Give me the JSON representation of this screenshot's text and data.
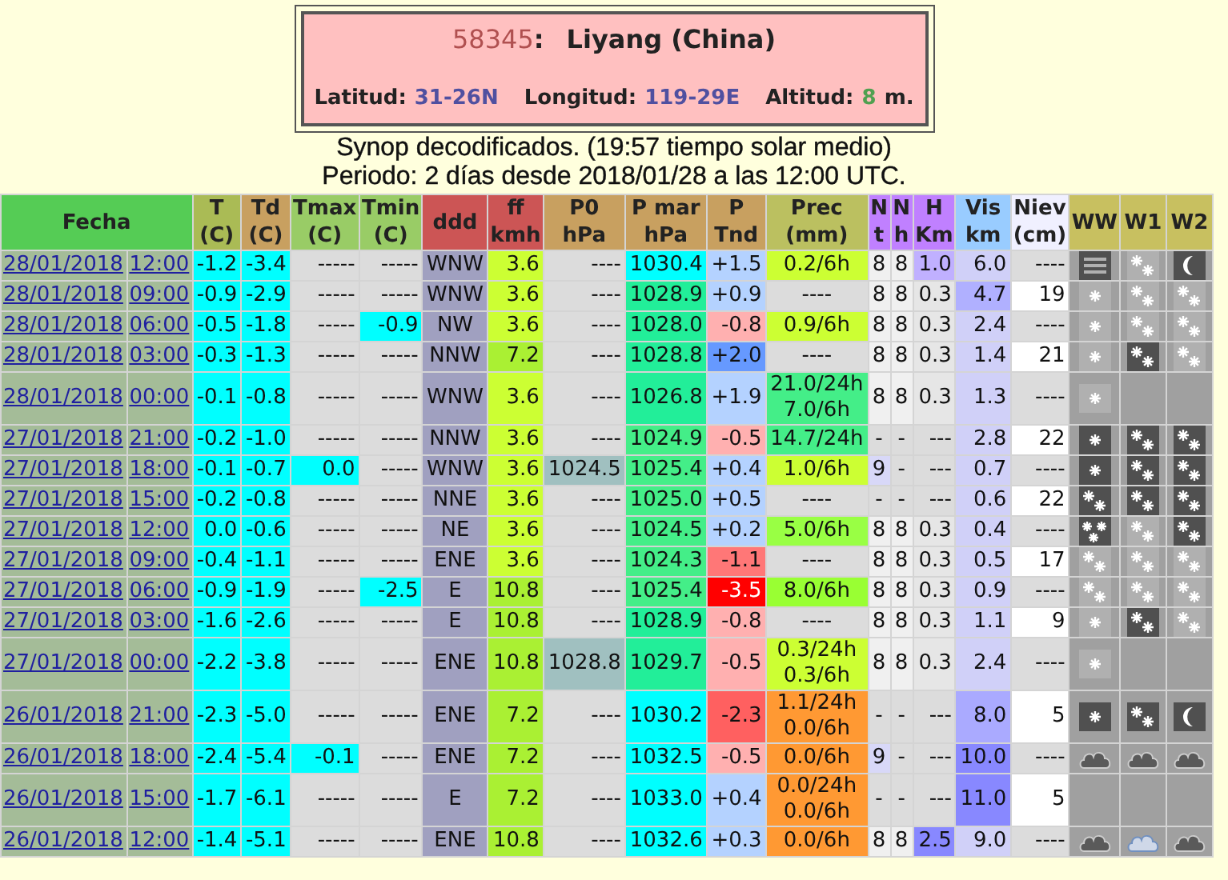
{
  "station": {
    "id": "58345",
    "id_suffix": ":",
    "name": "Liyang (China)",
    "coords": [
      {
        "label": "Latitud:",
        "value": "31-26N",
        "color": "#5050a0"
      },
      {
        "label": "Longitud:",
        "value": "119-29E",
        "color": "#5050a0"
      },
      {
        "label": "Altitud:",
        "value": "8",
        "color": "#50a050",
        "unit": "m."
      }
    ]
  },
  "subtitle": "Synop decodificados. (19:57 tiempo solar medio)",
  "period": "Periodo: 2 días desde 2018/01/28 a las 12:00 UTC.",
  "columns": [
    {
      "label": "Fecha",
      "color": "#55cc55"
    },
    {
      "label": "T\n(C)",
      "color": "#aabb55"
    },
    {
      "label": "Td\n(C)",
      "color": "#c8a060"
    },
    {
      "label": "Tmax\n(C)",
      "color": "#99cc66"
    },
    {
      "label": "Tmin\n(C)",
      "color": "#99cc66"
    },
    {
      "label": "ddd",
      "color": "#cc5555"
    },
    {
      "label": "ff\nkmh",
      "color": "#cc5555"
    },
    {
      "label": "P0\nhPa",
      "color": "#c8a060"
    },
    {
      "label": "P mar\nhPa",
      "color": "#c8a060"
    },
    {
      "label": "P\nTnd",
      "color": "#c8a060"
    },
    {
      "label": "Prec\n(mm)",
      "color": "#bbc060"
    },
    {
      "label": "N\nt",
      "color": "#c080ff"
    },
    {
      "label": "N\nh",
      "color": "#c080ff"
    },
    {
      "label": "H\nKm",
      "color": "#c080ff"
    },
    {
      "label": "Vis\nkm",
      "color": "#99ccff"
    },
    {
      "label": "Niev\n(cm)",
      "color": "#f0f0ff"
    },
    {
      "label": "WW",
      "color": "#c8c060"
    },
    {
      "label": "W1",
      "color": "#c8c060"
    },
    {
      "label": "W2",
      "color": "#c8c060"
    }
  ],
  "rows": [
    {
      "date": "28/01/2018",
      "time": "12:00",
      "cells": [
        {
          "text": "-1.2",
          "color": "#00ffff"
        },
        {
          "text": "-3.4",
          "color": "#00ffff"
        },
        {
          "text": "-----",
          "color": "#dcdcdc"
        },
        {
          "text": "-----",
          "color": "#dcdcdc"
        },
        {
          "text": "WNW",
          "color": "#a0a0c0"
        },
        {
          "text": "3.6",
          "color": "#ccff33"
        },
        {
          "text": "----",
          "color": "#dcdcdc"
        },
        {
          "text": "1030.4",
          "color": "#00ffff"
        },
        {
          "text": "+1.5",
          "color": "#b4d2ff"
        },
        {
          "text": "0.2/6h",
          "color": "#ccff33"
        },
        {
          "text": "8",
          "color": "#f0f0f0"
        },
        {
          "text": "8",
          "color": "#f0f0f0"
        },
        {
          "text": "1.0",
          "color": "#c0b0ff"
        },
        {
          "text": "6.0",
          "color": "#d0d0f8"
        },
        {
          "text": "----",
          "color": "#dcdcdc"
        }
      ],
      "icons": [
        {
          "kind": "fog",
          "dark": true
        },
        {
          "kind": "flakes",
          "dark": false
        },
        {
          "kind": "moon",
          "dark": true
        }
      ]
    },
    {
      "date": "28/01/2018",
      "time": "09:00",
      "cells": [
        {
          "text": "-0.9",
          "color": "#00ffff"
        },
        {
          "text": "-2.9",
          "color": "#00ffff"
        },
        {
          "text": "-----",
          "color": "#dcdcdc"
        },
        {
          "text": "-----",
          "color": "#dcdcdc"
        },
        {
          "text": "WNW",
          "color": "#a0a0c0"
        },
        {
          "text": "3.6",
          "color": "#ccff33"
        },
        {
          "text": "----",
          "color": "#dcdcdc"
        },
        {
          "text": "1028.9",
          "color": "#22ee99"
        },
        {
          "text": "+0.9",
          "color": "#b4d2ff"
        },
        {
          "text": "----",
          "color": "#dcdcdc"
        },
        {
          "text": "8",
          "color": "#f0f0f0"
        },
        {
          "text": "8",
          "color": "#f0f0f0"
        },
        {
          "text": "0.3",
          "color": "#e6e6e6"
        },
        {
          "text": "4.7",
          "color": "#b0b0ff"
        },
        {
          "text": "19",
          "color": "#ffffff"
        }
      ],
      "icons": [
        {
          "kind": "flake",
          "dark": false
        },
        {
          "kind": "flakes",
          "dark": false
        },
        {
          "kind": "flakes",
          "dark": false
        }
      ]
    },
    {
      "date": "28/01/2018",
      "time": "06:00",
      "cells": [
        {
          "text": "-0.5",
          "color": "#00ffff"
        },
        {
          "text": "-1.8",
          "color": "#00ffff"
        },
        {
          "text": "-----",
          "color": "#dcdcdc"
        },
        {
          "text": "-0.9",
          "color": "#00ffff"
        },
        {
          "text": "NW",
          "color": "#a0a0c0"
        },
        {
          "text": "3.6",
          "color": "#ccff33"
        },
        {
          "text": "----",
          "color": "#dcdcdc"
        },
        {
          "text": "1028.0",
          "color": "#22ee99"
        },
        {
          "text": "-0.8",
          "color": "#ffb0b0"
        },
        {
          "text": "0.9/6h",
          "color": "#ccff33"
        },
        {
          "text": "8",
          "color": "#f0f0f0"
        },
        {
          "text": "8",
          "color": "#f0f0f0"
        },
        {
          "text": "0.3",
          "color": "#e6e6e6"
        },
        {
          "text": "2.4",
          "color": "#d0d0f8"
        },
        {
          "text": "----",
          "color": "#dcdcdc"
        }
      ],
      "icons": [
        {
          "kind": "flake",
          "dark": false
        },
        {
          "kind": "flakes",
          "dark": false
        },
        {
          "kind": "flakes",
          "dark": false
        }
      ]
    },
    {
      "date": "28/01/2018",
      "time": "03:00",
      "cells": [
        {
          "text": "-0.3",
          "color": "#00ffff"
        },
        {
          "text": "-1.3",
          "color": "#00ffff"
        },
        {
          "text": "-----",
          "color": "#dcdcdc"
        },
        {
          "text": "-----",
          "color": "#dcdcdc"
        },
        {
          "text": "NNW",
          "color": "#a0a0c0"
        },
        {
          "text": "7.2",
          "color": "#aaf033"
        },
        {
          "text": "----",
          "color": "#dcdcdc"
        },
        {
          "text": "1028.8",
          "color": "#22ee99"
        },
        {
          "text": "+2.0",
          "color": "#6699ff"
        },
        {
          "text": "----",
          "color": "#dcdcdc"
        },
        {
          "text": "8",
          "color": "#f0f0f0"
        },
        {
          "text": "8",
          "color": "#f0f0f0"
        },
        {
          "text": "0.3",
          "color": "#e6e6e6"
        },
        {
          "text": "1.4",
          "color": "#d0d0f8"
        },
        {
          "text": "21",
          "color": "#ffffff"
        }
      ],
      "icons": [
        {
          "kind": "flake",
          "dark": false
        },
        {
          "kind": "flakes",
          "dark": true
        },
        {
          "kind": "flakes",
          "dark": false
        }
      ]
    },
    {
      "date": "28/01/2018",
      "time": "00:00",
      "cells": [
        {
          "text": "-0.1",
          "color": "#00ffff"
        },
        {
          "text": "-0.8",
          "color": "#00ffff"
        },
        {
          "text": "-----",
          "color": "#dcdcdc"
        },
        {
          "text": "-----",
          "color": "#dcdcdc"
        },
        {
          "text": "WNW",
          "color": "#a0a0c0"
        },
        {
          "text": "3.6",
          "color": "#ccff33"
        },
        {
          "text": "----",
          "color": "#dcdcdc"
        },
        {
          "text": "1026.8",
          "color": "#22ee99"
        },
        {
          "text": "+1.9",
          "color": "#b4d2ff"
        },
        {
          "text": "21.0/24h\n7.0/6h",
          "color": "#44ee88"
        },
        {
          "text": "8",
          "color": "#f0f0f0"
        },
        {
          "text": "8",
          "color": "#f0f0f0"
        },
        {
          "text": "0.3",
          "color": "#e6e6e6"
        },
        {
          "text": "1.3",
          "color": "#d0d0f8"
        },
        {
          "text": "----",
          "color": "#dcdcdc"
        }
      ],
      "icons": [
        {
          "kind": "flake",
          "dark": false
        }
      ]
    },
    {
      "date": "27/01/2018",
      "time": "21:00",
      "cells": [
        {
          "text": "-0.2",
          "color": "#00ffff"
        },
        {
          "text": "-1.0",
          "color": "#00ffff"
        },
        {
          "text": "-----",
          "color": "#dcdcdc"
        },
        {
          "text": "-----",
          "color": "#dcdcdc"
        },
        {
          "text": "NNW",
          "color": "#a0a0c0"
        },
        {
          "text": "3.6",
          "color": "#ccff33"
        },
        {
          "text": "----",
          "color": "#dcdcdc"
        },
        {
          "text": "1024.9",
          "color": "#44ee88"
        },
        {
          "text": "-0.5",
          "color": "#ffb0b0"
        },
        {
          "text": "14.7/24h",
          "color": "#44ee88"
        },
        {
          "text": "-",
          "color": "#dcdcdc"
        },
        {
          "text": "-",
          "color": "#dcdcdc"
        },
        {
          "text": "---",
          "color": "#dcdcdc"
        },
        {
          "text": "2.8",
          "color": "#d0d0f8"
        },
        {
          "text": "22",
          "color": "#ffffff"
        }
      ],
      "icons": [
        {
          "kind": "flake",
          "dark": true
        },
        {
          "kind": "flakes",
          "dark": true
        },
        {
          "kind": "flakes",
          "dark": true
        }
      ]
    },
    {
      "date": "27/01/2018",
      "time": "18:00",
      "cells": [
        {
          "text": "-0.1",
          "color": "#00ffff"
        },
        {
          "text": "-0.7",
          "color": "#00ffff"
        },
        {
          "text": "0.0",
          "color": "#00ffff"
        },
        {
          "text": "-----",
          "color": "#dcdcdc"
        },
        {
          "text": "WNW",
          "color": "#a0a0c0"
        },
        {
          "text": "3.6",
          "color": "#ccff33"
        },
        {
          "text": "1024.5",
          "color": "#a0c0c0"
        },
        {
          "text": "1025.4",
          "color": "#44ee88"
        },
        {
          "text": "+0.4",
          "color": "#b4d2ff"
        },
        {
          "text": "1.0/6h",
          "color": "#ccff33"
        },
        {
          "text": "9",
          "color": "#d8d8f8"
        },
        {
          "text": "-",
          "color": "#dcdcdc"
        },
        {
          "text": "---",
          "color": "#dcdcdc"
        },
        {
          "text": "0.7",
          "color": "#d0d0f8"
        },
        {
          "text": "----",
          "color": "#dcdcdc"
        }
      ],
      "icons": [
        {
          "kind": "flake",
          "dark": true
        },
        {
          "kind": "flakes",
          "dark": true
        },
        {
          "kind": "flakes",
          "dark": true
        }
      ]
    },
    {
      "date": "27/01/2018",
      "time": "15:00",
      "cells": [
        {
          "text": "-0.2",
          "color": "#00ffff"
        },
        {
          "text": "-0.8",
          "color": "#00ffff"
        },
        {
          "text": "-----",
          "color": "#dcdcdc"
        },
        {
          "text": "-----",
          "color": "#dcdcdc"
        },
        {
          "text": "NNE",
          "color": "#a0a0c0"
        },
        {
          "text": "3.6",
          "color": "#ccff33"
        },
        {
          "text": "----",
          "color": "#dcdcdc"
        },
        {
          "text": "1025.0",
          "color": "#44ee88"
        },
        {
          "text": "+0.5",
          "color": "#b4d2ff"
        },
        {
          "text": "----",
          "color": "#dcdcdc"
        },
        {
          "text": "-",
          "color": "#dcdcdc"
        },
        {
          "text": "-",
          "color": "#dcdcdc"
        },
        {
          "text": "---",
          "color": "#dcdcdc"
        },
        {
          "text": "0.6",
          "color": "#d0d0f8"
        },
        {
          "text": "22",
          "color": "#ffffff"
        }
      ],
      "icons": [
        {
          "kind": "flakes",
          "dark": true
        },
        {
          "kind": "flakes",
          "dark": true
        },
        {
          "kind": "flakes",
          "dark": true
        }
      ]
    },
    {
      "date": "27/01/2018",
      "time": "12:00",
      "cells": [
        {
          "text": "0.0",
          "color": "#00ffff"
        },
        {
          "text": "-0.6",
          "color": "#00ffff"
        },
        {
          "text": "-----",
          "color": "#dcdcdc"
        },
        {
          "text": "-----",
          "color": "#dcdcdc"
        },
        {
          "text": "NE",
          "color": "#a0a0c0"
        },
        {
          "text": "3.6",
          "color": "#ccff33"
        },
        {
          "text": "----",
          "color": "#dcdcdc"
        },
        {
          "text": "1024.5",
          "color": "#44ee88"
        },
        {
          "text": "+0.2",
          "color": "#b4d2ff"
        },
        {
          "text": "5.0/6h",
          "color": "#99ff44"
        },
        {
          "text": "8",
          "color": "#f0f0f0"
        },
        {
          "text": "8",
          "color": "#f0f0f0"
        },
        {
          "text": "0.3",
          "color": "#e6e6e6"
        },
        {
          "text": "0.4",
          "color": "#d0d0f8"
        },
        {
          "text": "----",
          "color": "#dcdcdc"
        }
      ],
      "icons": [
        {
          "kind": "flakes3",
          "dark": true
        },
        {
          "kind": "flakes",
          "dark": false
        },
        {
          "kind": "flakes",
          "dark": true
        }
      ]
    },
    {
      "date": "27/01/2018",
      "time": "09:00",
      "cells": [
        {
          "text": "-0.4",
          "color": "#00ffff"
        },
        {
          "text": "-1.1",
          "color": "#00ffff"
        },
        {
          "text": "-----",
          "color": "#dcdcdc"
        },
        {
          "text": "-----",
          "color": "#dcdcdc"
        },
        {
          "text": "ENE",
          "color": "#a0a0c0"
        },
        {
          "text": "3.6",
          "color": "#ccff33"
        },
        {
          "text": "----",
          "color": "#dcdcdc"
        },
        {
          "text": "1024.3",
          "color": "#44ee88"
        },
        {
          "text": "-1.1",
          "color": "#ff7777"
        },
        {
          "text": "----",
          "color": "#dcdcdc"
        },
        {
          "text": "8",
          "color": "#f0f0f0"
        },
        {
          "text": "8",
          "color": "#f0f0f0"
        },
        {
          "text": "0.3",
          "color": "#e6e6e6"
        },
        {
          "text": "0.5",
          "color": "#d0d0f8"
        },
        {
          "text": "17",
          "color": "#ffffff"
        }
      ],
      "icons": [
        {
          "kind": "flakes",
          "dark": false
        },
        {
          "kind": "flakes",
          "dark": false
        },
        {
          "kind": "flakes",
          "dark": false
        }
      ]
    },
    {
      "date": "27/01/2018",
      "time": "06:00",
      "cells": [
        {
          "text": "-0.9",
          "color": "#00ffff"
        },
        {
          "text": "-1.9",
          "color": "#00ffff"
        },
        {
          "text": "-----",
          "color": "#dcdcdc"
        },
        {
          "text": "-2.5",
          "color": "#00ffff"
        },
        {
          "text": "E",
          "color": "#a0a0c0"
        },
        {
          "text": "10.8",
          "color": "#aaf033"
        },
        {
          "text": "----",
          "color": "#dcdcdc"
        },
        {
          "text": "1025.4",
          "color": "#44ee88"
        },
        {
          "text": "-3.5",
          "color": "#ff0000"
        },
        {
          "text": "8.0/6h",
          "color": "#99ff33"
        },
        {
          "text": "8",
          "color": "#f0f0f0"
        },
        {
          "text": "8",
          "color": "#f0f0f0"
        },
        {
          "text": "0.3",
          "color": "#e6e6e6"
        },
        {
          "text": "0.9",
          "color": "#d0d0f8"
        },
        {
          "text": "----",
          "color": "#dcdcdc"
        }
      ],
      "icons": [
        {
          "kind": "flakes",
          "dark": false
        },
        {
          "kind": "flakes",
          "dark": false
        },
        {
          "kind": "flakes",
          "dark": false
        }
      ]
    },
    {
      "date": "27/01/2018",
      "time": "03:00",
      "cells": [
        {
          "text": "-1.6",
          "color": "#00ffff"
        },
        {
          "text": "-2.6",
          "color": "#00ffff"
        },
        {
          "text": "-----",
          "color": "#dcdcdc"
        },
        {
          "text": "-----",
          "color": "#dcdcdc"
        },
        {
          "text": "E",
          "color": "#a0a0c0"
        },
        {
          "text": "10.8",
          "color": "#aaf033"
        },
        {
          "text": "----",
          "color": "#dcdcdc"
        },
        {
          "text": "1028.9",
          "color": "#22ee99"
        },
        {
          "text": "-0.8",
          "color": "#ffb0b0"
        },
        {
          "text": "----",
          "color": "#dcdcdc"
        },
        {
          "text": "8",
          "color": "#f0f0f0"
        },
        {
          "text": "8",
          "color": "#f0f0f0"
        },
        {
          "text": "0.3",
          "color": "#e6e6e6"
        },
        {
          "text": "1.1",
          "color": "#d0d0f8"
        },
        {
          "text": "9",
          "color": "#ffffff"
        }
      ],
      "icons": [
        {
          "kind": "flake",
          "dark": false
        },
        {
          "kind": "flakes",
          "dark": true
        },
        {
          "kind": "flakes",
          "dark": false
        }
      ]
    },
    {
      "date": "27/01/2018",
      "time": "00:00",
      "cells": [
        {
          "text": "-2.2",
          "color": "#00ffff"
        },
        {
          "text": "-3.8",
          "color": "#00ffff"
        },
        {
          "text": "-----",
          "color": "#dcdcdc"
        },
        {
          "text": "-----",
          "color": "#dcdcdc"
        },
        {
          "text": "ENE",
          "color": "#a0a0c0"
        },
        {
          "text": "10.8",
          "color": "#aaf033"
        },
        {
          "text": "1028.8",
          "color": "#a0c0c0"
        },
        {
          "text": "1029.7",
          "color": "#22ee99"
        },
        {
          "text": "-0.5",
          "color": "#ffb0b0"
        },
        {
          "text": "0.3/24h\n0.3/6h",
          "color": "#ccff33"
        },
        {
          "text": "8",
          "color": "#f0f0f0"
        },
        {
          "text": "8",
          "color": "#f0f0f0"
        },
        {
          "text": "0.3",
          "color": "#e6e6e6"
        },
        {
          "text": "2.4",
          "color": "#d0d0f8"
        },
        {
          "text": "----",
          "color": "#dcdcdc"
        }
      ],
      "icons": [
        {
          "kind": "flake",
          "dark": false
        }
      ]
    },
    {
      "date": "26/01/2018",
      "time": "21:00",
      "cells": [
        {
          "text": "-2.3",
          "color": "#00ffff"
        },
        {
          "text": "-5.0",
          "color": "#00ffff"
        },
        {
          "text": "-----",
          "color": "#dcdcdc"
        },
        {
          "text": "-----",
          "color": "#dcdcdc"
        },
        {
          "text": "ENE",
          "color": "#a0a0c0"
        },
        {
          "text": "7.2",
          "color": "#aaf033"
        },
        {
          "text": "----",
          "color": "#dcdcdc"
        },
        {
          "text": "1030.2",
          "color": "#00ffff"
        },
        {
          "text": "-2.3",
          "color": "#ff6060"
        },
        {
          "text": "1.1/24h\n0.0/6h",
          "color": "#ff9933"
        },
        {
          "text": "-",
          "color": "#dcdcdc"
        },
        {
          "text": "-",
          "color": "#dcdcdc"
        },
        {
          "text": "---",
          "color": "#dcdcdc"
        },
        {
          "text": "8.0",
          "color": "#aaaaff"
        },
        {
          "text": "5",
          "color": "#ffffff"
        }
      ],
      "icons": [
        {
          "kind": "flake",
          "dark": true
        },
        {
          "kind": "flakes",
          "dark": true
        },
        {
          "kind": "moon",
          "dark": true
        }
      ]
    },
    {
      "date": "26/01/2018",
      "time": "18:00",
      "cells": [
        {
          "text": "-2.4",
          "color": "#00ffff"
        },
        {
          "text": "-5.4",
          "color": "#00ffff"
        },
        {
          "text": "-0.1",
          "color": "#00ffff"
        },
        {
          "text": "-----",
          "color": "#dcdcdc"
        },
        {
          "text": "ENE",
          "color": "#a0a0c0"
        },
        {
          "text": "7.2",
          "color": "#aaf033"
        },
        {
          "text": "----",
          "color": "#dcdcdc"
        },
        {
          "text": "1032.5",
          "color": "#00ffff"
        },
        {
          "text": "-0.5",
          "color": "#ffb0b0"
        },
        {
          "text": "0.0/6h",
          "color": "#ff9933"
        },
        {
          "text": "9",
          "color": "#d8d8f8"
        },
        {
          "text": "-",
          "color": "#dcdcdc"
        },
        {
          "text": "---",
          "color": "#dcdcdc"
        },
        {
          "text": "10.0",
          "color": "#8888ff"
        },
        {
          "text": "----",
          "color": "#dcdcdc"
        }
      ],
      "icons": [
        {
          "kind": "cloud",
          "dark": true
        },
        {
          "kind": "cloud",
          "dark": true
        },
        {
          "kind": "cloud",
          "dark": true
        }
      ]
    },
    {
      "date": "26/01/2018",
      "time": "15:00",
      "cells": [
        {
          "text": "-1.7",
          "color": "#00ffff"
        },
        {
          "text": "-6.1",
          "color": "#00ffff"
        },
        {
          "text": "-----",
          "color": "#dcdcdc"
        },
        {
          "text": "-----",
          "color": "#dcdcdc"
        },
        {
          "text": "E",
          "color": "#a0a0c0"
        },
        {
          "text": "7.2",
          "color": "#aaf033"
        },
        {
          "text": "----",
          "color": "#dcdcdc"
        },
        {
          "text": "1033.0",
          "color": "#00ffff"
        },
        {
          "text": "+0.4",
          "color": "#b4d2ff"
        },
        {
          "text": "0.0/24h\n0.0/6h",
          "color": "#ff9933"
        },
        {
          "text": "-",
          "color": "#dcdcdc"
        },
        {
          "text": "-",
          "color": "#dcdcdc"
        },
        {
          "text": "---",
          "color": "#dcdcdc"
        },
        {
          "text": "11.0",
          "color": "#8888ff"
        },
        {
          "text": "5",
          "color": "#ffffff"
        }
      ],
      "icons": []
    },
    {
      "date": "26/01/2018",
      "time": "12:00",
      "cells": [
        {
          "text": "-1.4",
          "color": "#00ffff"
        },
        {
          "text": "-5.1",
          "color": "#00ffff"
        },
        {
          "text": "-----",
          "color": "#dcdcdc"
        },
        {
          "text": "-----",
          "color": "#dcdcdc"
        },
        {
          "text": "ENE",
          "color": "#a0a0c0"
        },
        {
          "text": "10.8",
          "color": "#aaf033"
        },
        {
          "text": "----",
          "color": "#dcdcdc"
        },
        {
          "text": "1032.6",
          "color": "#00ffff"
        },
        {
          "text": "+0.3",
          "color": "#b4d2ff"
        },
        {
          "text": "0.0/6h",
          "color": "#ff9933"
        },
        {
          "text": "8",
          "color": "#f0f0f0"
        },
        {
          "text": "8",
          "color": "#f0f0f0"
        },
        {
          "text": "2.5",
          "color": "#8888ff"
        },
        {
          "text": "9.0",
          "color": "#d0d0f8"
        },
        {
          "text": "----",
          "color": "#dcdcdc"
        }
      ],
      "icons": [
        {
          "kind": "cloud",
          "dark": true
        },
        {
          "kind": "cloud",
          "dark": false
        },
        {
          "kind": "cloud",
          "dark": true
        }
      ]
    }
  ]
}
